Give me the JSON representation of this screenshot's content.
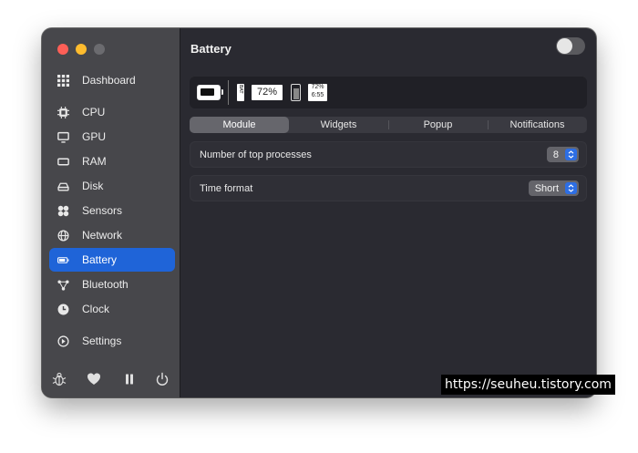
{
  "sidebar": {
    "items": [
      {
        "label": "Dashboard",
        "icon": "grid-icon"
      },
      {
        "label": "CPU",
        "icon": "cpu-icon"
      },
      {
        "label": "GPU",
        "icon": "monitor-icon"
      },
      {
        "label": "RAM",
        "icon": "memory-icon"
      },
      {
        "label": "Disk",
        "icon": "disk-icon"
      },
      {
        "label": "Sensors",
        "icon": "fan-icon"
      },
      {
        "label": "Network",
        "icon": "globe-icon"
      },
      {
        "label": "Battery",
        "icon": "battery-icon",
        "active": true
      },
      {
        "label": "Bluetooth",
        "icon": "bluetooth-icon"
      },
      {
        "label": "Clock",
        "icon": "clock-icon"
      },
      {
        "label": "Settings",
        "icon": "settings-icon"
      }
    ],
    "footer_icons": [
      "bug-icon",
      "heart-icon",
      "pause-icon",
      "power-icon"
    ]
  },
  "header": {
    "title": "Battery",
    "module_enabled": false
  },
  "preview": {
    "bat_vertical_text": "BAT",
    "percentage": "72%",
    "two_line_top": "72%",
    "two_line_bottom": "6:55"
  },
  "tabs": [
    {
      "label": "Module",
      "active": true
    },
    {
      "label": "Widgets"
    },
    {
      "label": "Popup"
    },
    {
      "label": "Notifications"
    }
  ],
  "settings": {
    "top_processes": {
      "label": "Number of top processes",
      "value": "8"
    },
    "time_format": {
      "label": "Time format",
      "value": "Short"
    }
  },
  "watermark": "https://seuheu.tistory.com",
  "colors": {
    "accent": "#1f64d8",
    "sidebar_bg": "#47474b",
    "main_bg": "#2a2a31",
    "close": "#fe5f57",
    "minimize": "#febc2e"
  }
}
